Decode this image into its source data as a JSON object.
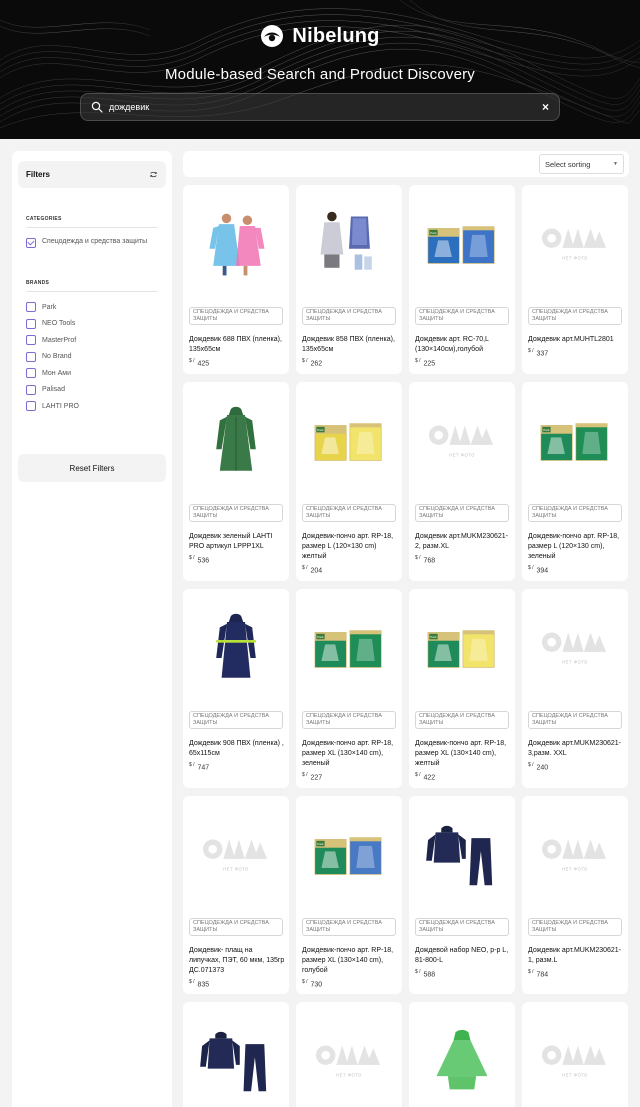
{
  "hero": {
    "brand": "Nibelung",
    "title": "Module-based Search and Product Discovery",
    "search_value": "дождевик",
    "clear_label": "×"
  },
  "sidebar": {
    "filters_title": "Filters",
    "categories_title": "CATEGORIES",
    "categories": [
      {
        "label": "Спецодежда и средства защиты",
        "checked": true
      }
    ],
    "brands_title": "BRANDS",
    "brands": [
      "Park",
      "NEO Tools",
      "MasterProf",
      "No Brand",
      "Мон Ами",
      "Palisad",
      "LAHTI PRO"
    ],
    "reset_label": "Reset Filters"
  },
  "sort": {
    "label": "Select sorting"
  },
  "accent_color": "#7b6cd8",
  "no_photo_text": "НЕТ ФОТО",
  "currency": "$",
  "products": [
    {
      "badge": "СПЕЦОДЕЖДА И СРЕДСТВА ЗАЩИТЫ",
      "name": "Дождевик 688 ПВХ (пленка), 135х65см",
      "price": "425",
      "img": "raincoat-pair"
    },
    {
      "badge": "СПЕЦОДЕЖДА И СРЕДСТВА ЗАЩИТЫ",
      "name": "Дождевик 858 ПВХ (пленка), 135х65см",
      "price": "262",
      "img": "raincoat-pair-2"
    },
    {
      "badge": "СПЕЦОДЕЖДА И СРЕДСТВА ЗАЩИТЫ",
      "name": "Дождевик арт. RC-70,L (130×140см),голубой",
      "price": "225",
      "img": "pack-blue"
    },
    {
      "badge": "СПЕЦОДЕЖДА И СРЕДСТВА ЗАЩИТЫ",
      "name": "Дождевик арт.MUHTL2801",
      "price": "337",
      "img": "no-photo"
    },
    {
      "badge": "СПЕЦОДЕЖДА И СРЕДСТВА ЗАЩИТЫ",
      "name": "Дождевик зеленый LAHTI PRO артикул LPPP1XL",
      "price": "536",
      "img": "coat-green"
    },
    {
      "badge": "СПЕЦОДЕЖДА И СРЕДСТВА ЗАЩИТЫ",
      "name": "Дождевик-пончо арт. RP-18, размер L (120×130 cm) желтый",
      "price": "204",
      "img": "pack-yellow"
    },
    {
      "badge": "СПЕЦОДЕЖДА И СРЕДСТВА ЗАЩИТЫ",
      "name": "Дождевик арт.MUKM230621-2, разм.XL",
      "price": "768",
      "img": "no-photo"
    },
    {
      "badge": "СПЕЦОДЕЖДА И СРЕДСТВА ЗАЩИТЫ",
      "name": "Дождевик-пончо арт. RP-18, размер L (120×130 cm), зеленый",
      "price": "394",
      "img": "pack-green"
    },
    {
      "badge": "СПЕЦОДЕЖДА И СРЕДСТВА ЗАЩИТЫ",
      "name": "Дождевик 908 ПВХ (пленка) , 65х115см",
      "price": "747",
      "img": "coat-navy"
    },
    {
      "badge": "СПЕЦОДЕЖДА И СРЕДСТВА ЗАЩИТЫ",
      "name": "Дождевик-пончо арт. RP-18, размер XL (130×140 cm), зеленый",
      "price": "227",
      "img": "pack-green"
    },
    {
      "badge": "СПЕЦОДЕЖДА И СРЕДСТВА ЗАЩИТЫ",
      "name": "Дождевик-пончо арт. RP-18, размер XL (130×140 cm), желтый",
      "price": "422",
      "img": "pack-yellow-green"
    },
    {
      "badge": "СПЕЦОДЕЖДА И СРЕДСТВА ЗАЩИТЫ",
      "name": "Дождевик арт.MUKM230621-3,разм. XXL",
      "price": "240",
      "img": "no-photo"
    },
    {
      "badge": "СПЕЦОДЕЖДА И СРЕДСТВА ЗАЩИТЫ",
      "name": "Дождевик- плащ на липучках, ПЭТ, 60 мкм, 135гр ДС.071373",
      "price": "835",
      "img": "no-photo"
    },
    {
      "badge": "СПЕЦОДЕЖДА И СРЕДСТВА ЗАЩИТЫ",
      "name": "Дождевик-пончо арт. RP-18, размер XL (130×140 cm), голубой",
      "price": "730",
      "img": "pack-green-blue"
    },
    {
      "badge": "СПЕЦОДЕЖДА И СРЕДСТВА ЗАЩИТЫ",
      "name": "Дождевой набор NEO, р-р L, 81-800-L",
      "price": "588",
      "img": "suit-navy"
    },
    {
      "badge": "СПЕЦОДЕЖДА И СРЕДСТВА ЗАЩИТЫ",
      "name": "Дождевик арт.MUKM230621-1, разм.L",
      "price": "784",
      "img": "no-photo"
    },
    {
      "badge": "",
      "name": "",
      "price": "",
      "img": "suit-navy"
    },
    {
      "badge": "",
      "name": "",
      "price": "",
      "img": "no-photo"
    },
    {
      "badge": "",
      "name": "",
      "price": "",
      "img": "poncho-green"
    },
    {
      "badge": "",
      "name": "",
      "price": "",
      "img": "no-photo"
    }
  ]
}
